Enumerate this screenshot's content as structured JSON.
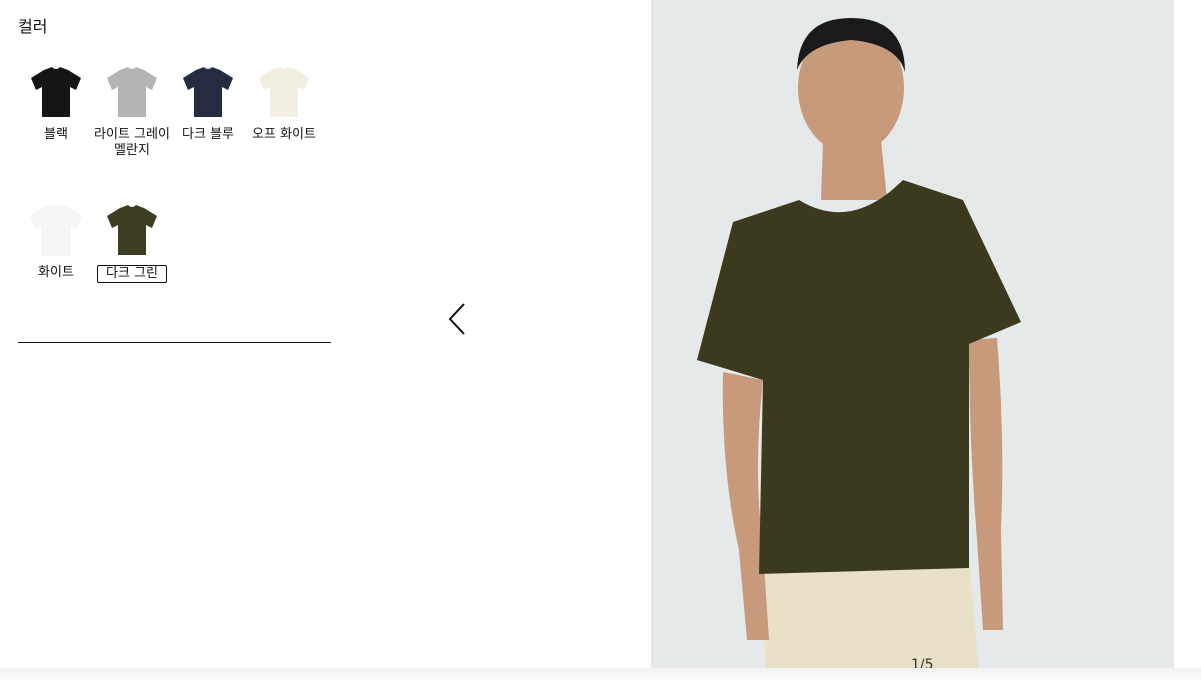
{
  "color_section": {
    "title": "컬러",
    "swatches": [
      {
        "label": "블랙",
        "color": "#151515",
        "icon": "tshirt-icon",
        "selected": false
      },
      {
        "label": "라이트 그레이 멜란지",
        "color": "#b4b4b4",
        "icon": "tshirt-icon",
        "selected": false
      },
      {
        "label": "다크 블루",
        "color": "#252c40",
        "icon": "tshirt-icon",
        "selected": false
      },
      {
        "label": "오프 화이트",
        "color": "#f1ede1",
        "icon": "tshirt-icon",
        "selected": false
      },
      {
        "label": "화이트",
        "color": "#f6f6f6",
        "icon": "tshirt-icon",
        "selected": false
      },
      {
        "label": "다크 그린",
        "color": "#3e3f22",
        "icon": "tshirt-icon",
        "selected": true
      }
    ]
  },
  "gallery": {
    "prev_icon": "chevron-left-icon",
    "counter": "1/5",
    "colors": {
      "background": "#e6e9ea",
      "tshirt": "#3b3a1e",
      "skin": "#c79a7b",
      "hair": "#1a1a1a",
      "trousers": "#e9e0c8"
    }
  }
}
